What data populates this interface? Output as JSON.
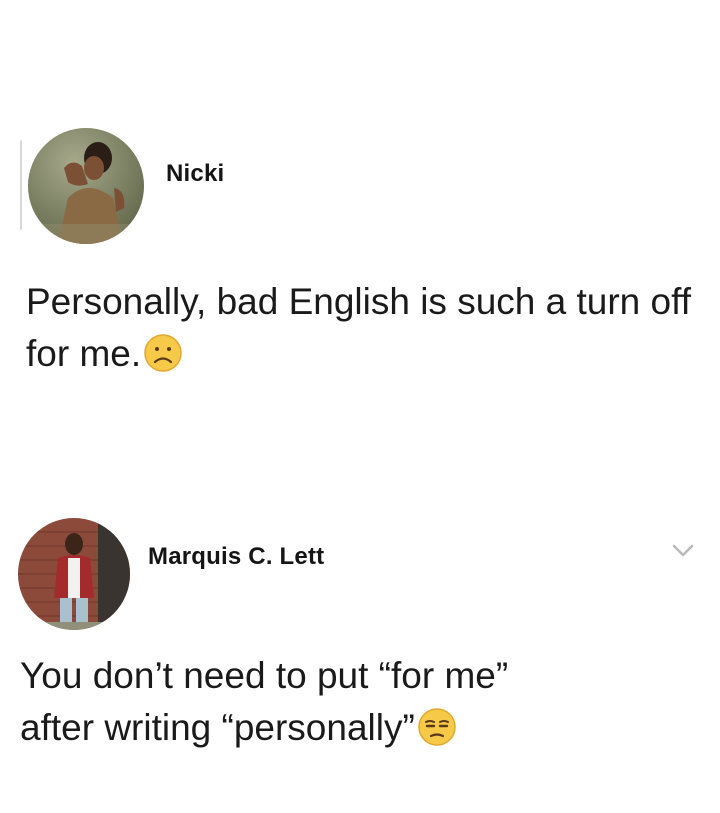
{
  "posts": [
    {
      "author": "Nicki",
      "text": "Personally, bad English is such a turn off for me.",
      "emoji": "frowning-face-emoji"
    },
    {
      "author": "Marquis C. Lett",
      "line1": "You don’t need to put “for me”",
      "line2": "after writing “personally”",
      "emoji": "unamused-face-emoji",
      "menu_icon": "chevron-down-icon"
    }
  ],
  "colors": {
    "background": "#ffffff",
    "text": "#1a1a1a",
    "emoji_yellow": "#f7c948",
    "chevron": "#b9b9b9"
  }
}
